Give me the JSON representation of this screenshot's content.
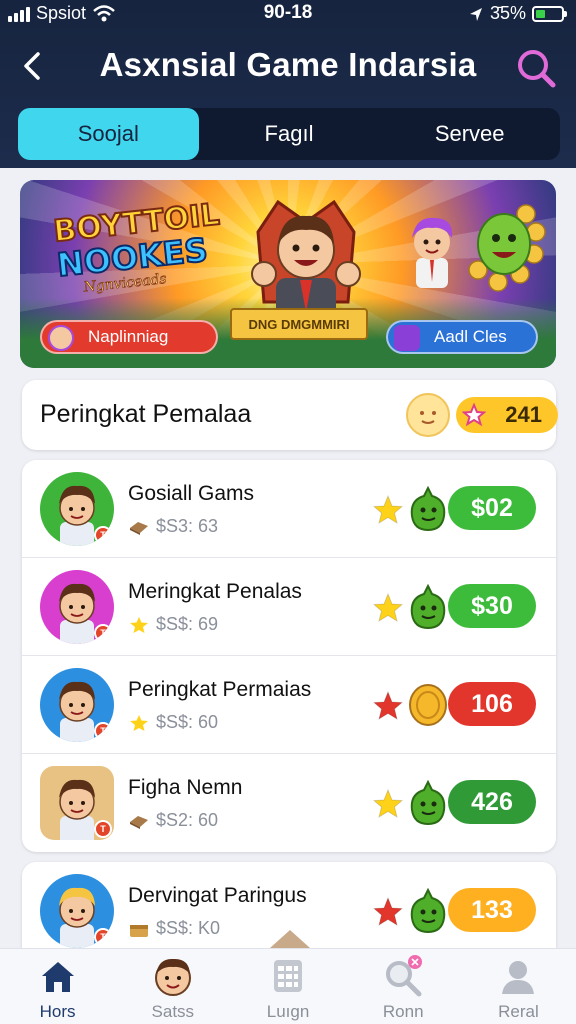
{
  "status": {
    "carrier": "Spsiot",
    "time": "90-18",
    "battery": "3̄5%"
  },
  "header": {
    "title": "Asxnsial Game Indarsia"
  },
  "tabs": [
    {
      "label": "Soojal",
      "active": true
    },
    {
      "label": "Fagıl",
      "active": false
    },
    {
      "label": "Servee",
      "active": false
    }
  ],
  "banner": {
    "logo_line1": "BOYTTOIL",
    "logo_line2": "NOOKES",
    "logo_line3": "Ngnviceads",
    "ribbon": "DNG DMGMMIRI",
    "left_button": "Naplinniag",
    "right_button": "Aadl Cles"
  },
  "ranking": {
    "title": "Peringkat Pemalaa",
    "points": "241"
  },
  "players": [
    {
      "name": "Gosiall Gams",
      "sub": "$S3: 63",
      "score": "$02",
      "score_color": "#3dbb3a",
      "star_color": "#ffd21a",
      "mini": "blob",
      "avatar_bg": "#3fb43a",
      "sub_icon": "block"
    },
    {
      "name": "Meringkat Penalas",
      "sub": "$S$: 69",
      "score": "$30",
      "score_color": "#3dbb3a",
      "star_color": "#ffd21a",
      "mini": "blob",
      "avatar_bg": "#d83fcf",
      "sub_icon": "star"
    },
    {
      "name": "Peringkat Permaias",
      "sub": "$S$: 60",
      "score": "106",
      "score_color": "#e2362c",
      "star_color": "#e2362c",
      "mini": "coin",
      "avatar_bg": "#2d8fe0",
      "sub_icon": "star"
    },
    {
      "name": "Figha Nemn",
      "sub": "$S2: 60",
      "score": "426",
      "score_color": "#2f9a36",
      "star_color": "#ffd21a",
      "mini": "blob",
      "avatar_bg": "#e8c283",
      "sub_icon": "block"
    },
    {
      "name": "Dervingat Paringus",
      "sub": "$S$: K0",
      "score": "133",
      "score_color": "#ffb020",
      "star_color": "#e2362c",
      "mini": "blob",
      "avatar_bg": "#2d8fe0",
      "sub_icon": "box"
    }
  ],
  "bottom_nav": [
    {
      "label": "Hors",
      "icon": "home-icon",
      "active": true
    },
    {
      "label": "Satss",
      "icon": "avatar-icon",
      "active": false
    },
    {
      "label": "Luıgn",
      "icon": "grid-icon",
      "active": false
    },
    {
      "label": "Ronn",
      "icon": "search-icon",
      "active": false
    },
    {
      "label": "Reral",
      "icon": "profile-icon",
      "active": false
    }
  ]
}
